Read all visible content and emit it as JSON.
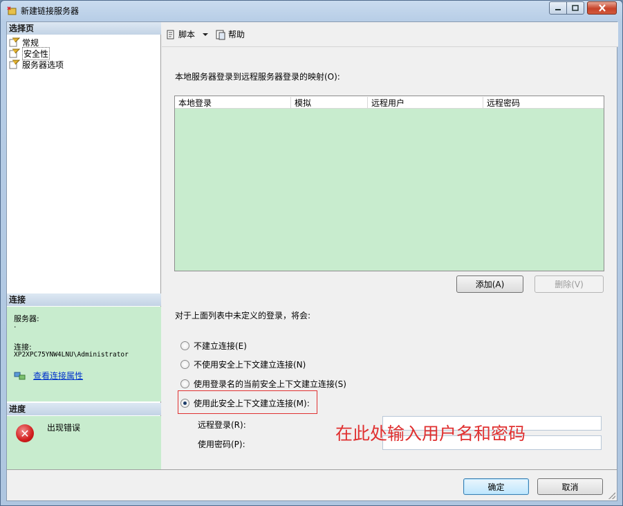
{
  "window": {
    "title": "新建链接服务器"
  },
  "left_panel": {
    "select_page_header": "选择页",
    "pages": [
      {
        "label": "常规"
      },
      {
        "label": "安全性"
      },
      {
        "label": "服务器选项"
      }
    ],
    "connection_header": "连接",
    "server_label": "服务器:",
    "server_value": ".",
    "connection_label": "连接:",
    "connection_value": "XP2XPC75YNW4LNU\\Administrator",
    "view_connection_properties": "查看连接属性",
    "progress_header": "进度",
    "progress_status": "出现错误"
  },
  "toolbar": {
    "script_label": "脚本",
    "help_label": "帮助"
  },
  "security": {
    "mapping_label": "本地服务器登录到远程服务器登录的映射(O):",
    "columns": [
      "本地登录",
      "模拟",
      "远程用户",
      "远程密码"
    ],
    "add_button": "添加(A)",
    "remove_button": "删除(V)",
    "undefined_login_label": "对于上面列表中未定义的登录，将会:",
    "options": [
      {
        "label": "不建立连接(E)",
        "selected": false
      },
      {
        "label": "不使用安全上下文建立连接(N)",
        "selected": false
      },
      {
        "label": "使用登录名的当前安全上下文建立连接(S)",
        "selected": false
      },
      {
        "label": "使用此安全上下文建立连接(M):",
        "selected": true
      }
    ],
    "remote_login_label": "远程登录(R):",
    "remote_login_value": "",
    "password_label": "使用密码(P):",
    "password_value": "",
    "annotation": "在此处输入用户名和密码"
  },
  "footer": {
    "ok_button": "确定",
    "cancel_button": "取消"
  },
  "colors": {
    "grid_background": "#c8ecce",
    "annotation": "#e03030",
    "link": "#0033cc"
  }
}
